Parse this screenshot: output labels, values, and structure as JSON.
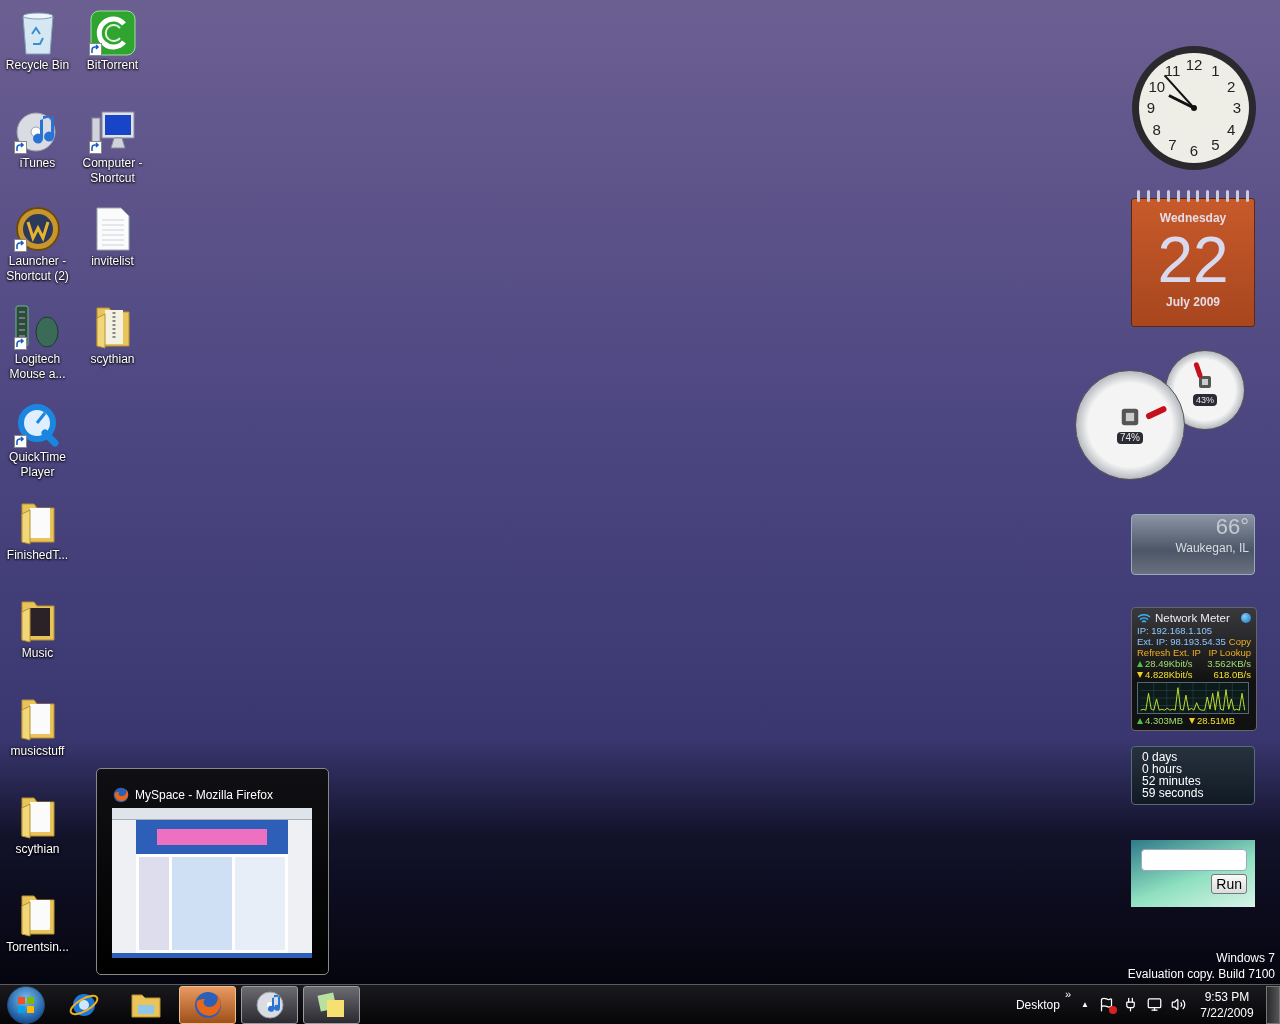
{
  "desktop": {
    "icon_columns": [
      [
        {
          "label": "Recycle Bin",
          "kind": "recycle-bin",
          "shortcut": false
        },
        {
          "label": "iTunes",
          "kind": "itunes",
          "shortcut": true
        },
        {
          "label": "Launcher - Shortcut (2)",
          "kind": "game-emblem",
          "shortcut": true
        },
        {
          "label": "Logitech Mouse a...",
          "kind": "keyboard-mouse",
          "shortcut": true
        },
        {
          "label": "QuickTime Player",
          "kind": "quicktime",
          "shortcut": true
        },
        {
          "label": "FinishedT...",
          "kind": "folder",
          "shortcut": false
        },
        {
          "label": "Music",
          "kind": "music-folder",
          "shortcut": false
        },
        {
          "label": "musicstuff",
          "kind": "folder",
          "shortcut": false
        },
        {
          "label": "scythian",
          "kind": "folder",
          "shortcut": false
        },
        {
          "label": "Torrentsin...",
          "kind": "folder",
          "shortcut": false
        }
      ],
      [
        {
          "label": "BitTorrent",
          "kind": "torrent",
          "shortcut": true
        },
        {
          "label": "Computer - Shortcut",
          "kind": "computer",
          "shortcut": true
        },
        {
          "label": "invitelist",
          "kind": "document",
          "shortcut": false
        },
        {
          "label": "scythian",
          "kind": "zip-folder",
          "shortcut": false
        }
      ]
    ],
    "os_notice": [
      "Windows 7",
      "Evaluation copy. Build 7100"
    ]
  },
  "taskbar_preview": {
    "title": "MySpace - Mozilla Firefox"
  },
  "gadgets": {
    "clock": {
      "numerals": [
        "12",
        "11",
        "1",
        "10",
        "2",
        "9",
        "3",
        "8",
        "4",
        "7",
        "5",
        "6"
      ]
    },
    "calendar": {
      "weekday": "Wednesday",
      "day": "22",
      "month_year": "July 2009"
    },
    "meters": [
      {
        "kind": "memory",
        "level": 0.43,
        "reading": "43%"
      },
      {
        "kind": "cpu",
        "level": 0.74,
        "reading": "74%"
      }
    ],
    "weather": {
      "temperature": "66°",
      "location": "Waukegan, IL"
    },
    "network_meter": {
      "title": "Network Meter",
      "ip": "IP: 192.168.1.105",
      "ext_ip": "Ext. IP: 98.193.54.35",
      "copy_link": "Copy",
      "refresh_link": "Refresh Ext. IP",
      "lookup_link": "IP Lookup",
      "upload": {
        "rate_bits": "28.49Kbit/s",
        "rate_bytes": "3.562KB/s",
        "total": "4.303MB"
      },
      "download": {
        "rate_bits": "4.828Kbit/s",
        "rate_bytes": "618.0B/s",
        "total": "28.51MB"
      }
    },
    "uptime": {
      "lines": [
        "0 days",
        "0 hours",
        "52 minutes",
        "59 seconds"
      ]
    },
    "run": {
      "button": "Run"
    }
  },
  "taskbar": {
    "buttons": [
      {
        "kind": "browser-e",
        "running": false,
        "highlighted": false
      },
      {
        "kind": "folder",
        "running": false,
        "highlighted": false
      },
      {
        "kind": "firefox",
        "running": true,
        "highlighted": true
      },
      {
        "kind": "itunes",
        "running": true,
        "highlighted": false
      },
      {
        "kind": "notes",
        "running": true,
        "highlighted": false
      }
    ],
    "toolbar_label": "Desktop",
    "toolbar_chevron": "»",
    "tray_arrow": "▲",
    "tray_icons": [
      {
        "kind": "flag"
      },
      {
        "kind": "power"
      },
      {
        "kind": "network"
      },
      {
        "kind": "volume"
      }
    ],
    "time": "9:53 PM",
    "date": "7/22/2009"
  }
}
